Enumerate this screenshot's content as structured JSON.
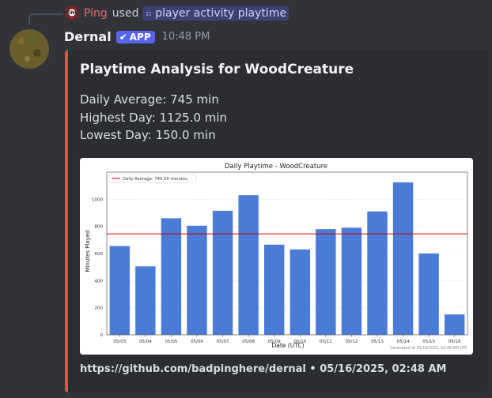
{
  "reply": {
    "username": "Ping",
    "used_text": "used",
    "command": "player activity playtime",
    "avatar_text": "PING"
  },
  "message": {
    "author": "Dernal",
    "badge": "APP",
    "time": "10:48 PM"
  },
  "embed": {
    "accent_color": "#e74c4c",
    "title": "Playtime Analysis for WoodCreature",
    "lines": [
      "Daily Average: 745 min",
      "Highest Day: 1125.0 min",
      "Lowest Day: 150.0 min"
    ],
    "footer": "https://github.com/badpinghere/dernal • 05/16/2025, 02:48 AM"
  },
  "chart_data": {
    "type": "bar",
    "title": "Daily Playtime - WoodCreature",
    "xlabel": "Date (UTC)",
    "ylabel": "Minutes Played",
    "categories": [
      "05/03",
      "05/04",
      "05/05",
      "05/06",
      "05/07",
      "05/08",
      "05/09",
      "05/10",
      "05/11",
      "05/12",
      "05/13",
      "05/14",
      "05/15",
      "05/16"
    ],
    "values": [
      655,
      505,
      860,
      805,
      915,
      1030,
      665,
      630,
      780,
      790,
      910,
      1125,
      600,
      150
    ],
    "ylim": [
      0,
      1200
    ],
    "yticks": [
      0,
      200,
      400,
      600,
      800,
      1000
    ],
    "average_line": {
      "value": 745,
      "label": "Daily Average: 745.00 minutes",
      "color": "#cc0000"
    },
    "bar_color": "#4a7bd6",
    "grid": true,
    "legend_position": "top-left",
    "note": "Generated at 05/16/2025, 02:48 AM UTC"
  }
}
